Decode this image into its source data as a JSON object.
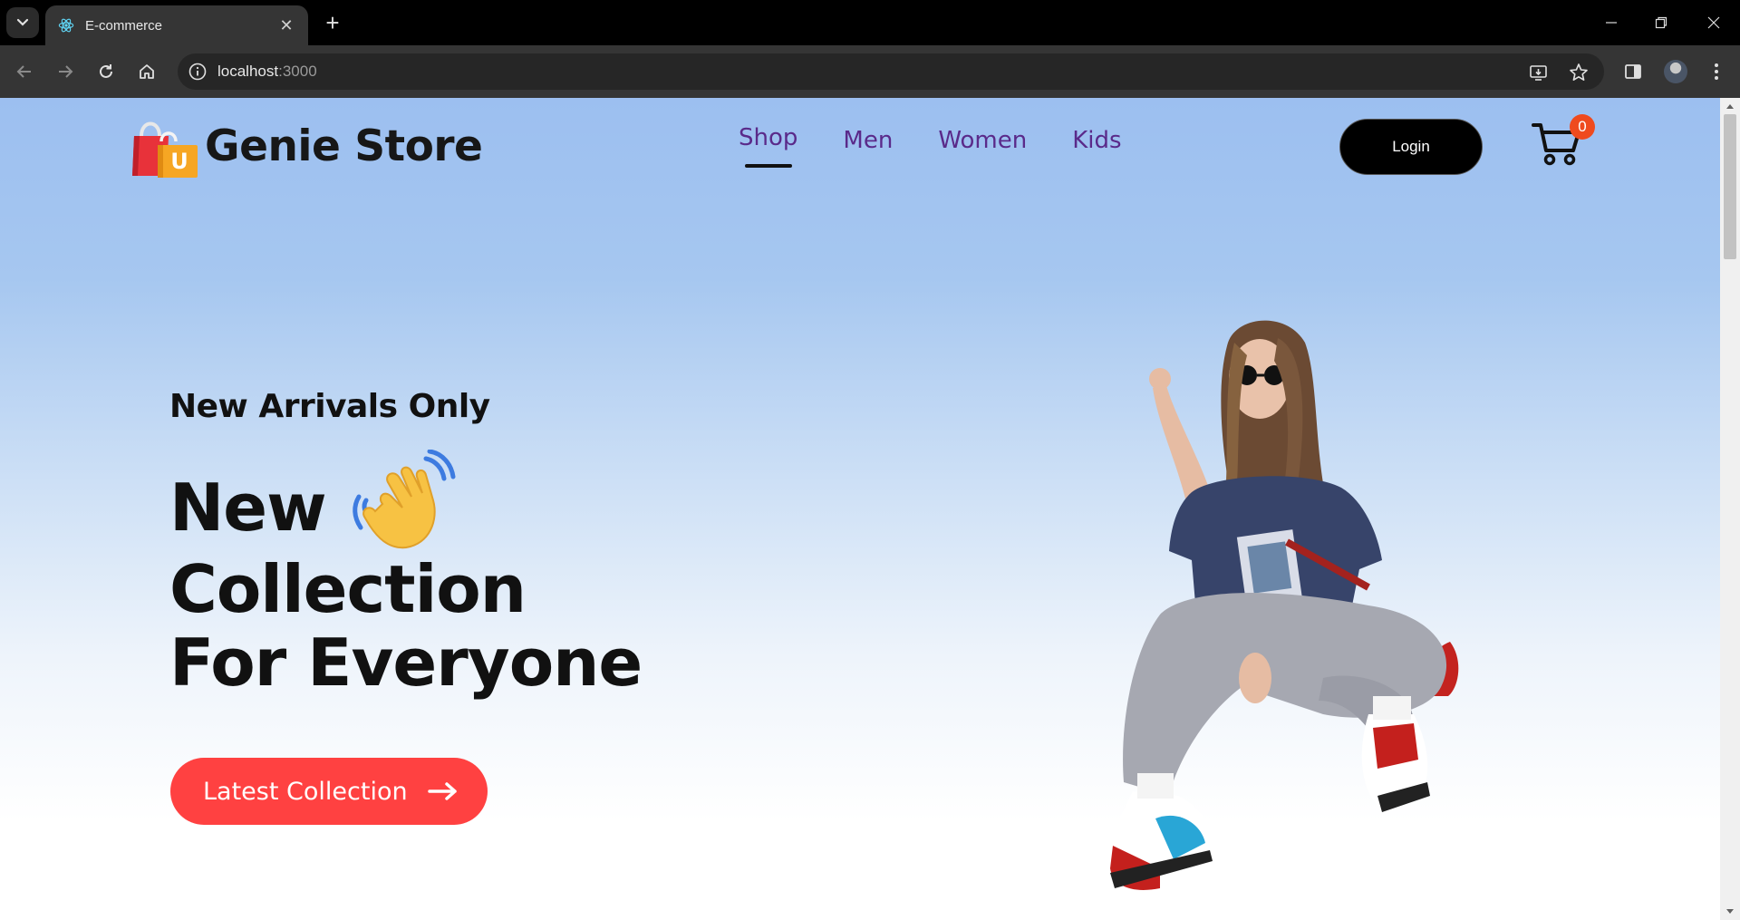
{
  "browser": {
    "tab_title": "E-commerce",
    "url_host": "localhost",
    "url_port": ":3000"
  },
  "nav": {
    "brand": "Genie Store",
    "logo_letter": "U",
    "menu": [
      {
        "label": "Shop",
        "active": true
      },
      {
        "label": "Men",
        "active": false
      },
      {
        "label": "Women",
        "active": false
      },
      {
        "label": "Kids",
        "active": false
      }
    ],
    "login_label": "Login",
    "cart_count": "0"
  },
  "hero": {
    "subtitle": "New Arrivals Only",
    "headline_word": "New",
    "headline_line2": "Collection",
    "headline_line3": "For Everyone",
    "cta_label": "Latest Collection"
  },
  "colors": {
    "cta": "#ff4141",
    "menu_text": "#5a2a8a",
    "badge": "#ef4a1e"
  }
}
